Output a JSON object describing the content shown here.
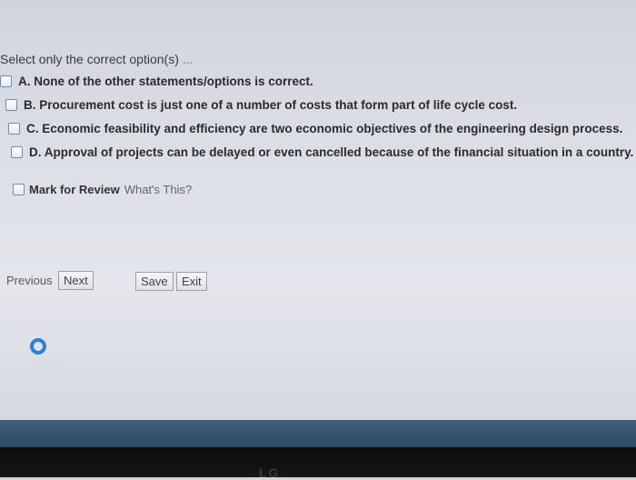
{
  "instruction": {
    "text": "Select only the correct option(s)",
    "ellipsis": "..."
  },
  "options": [
    {
      "label": "A. None of the other statements/options is correct."
    },
    {
      "label": "B. Procurement cost is just one of a number of costs that form part of life cycle cost."
    },
    {
      "label": "C. Economic feasibility and efficiency are two economic objectives of the engineering design process."
    },
    {
      "label": "D. Approval of projects can be delayed or even cancelled because of the financial situation in a country."
    }
  ],
  "review": {
    "label": "Mark for Review",
    "help_link": "What's This?"
  },
  "nav": {
    "previous": "Previous",
    "next": "Next",
    "save": "Save",
    "exit": "Exit"
  },
  "bezel": {
    "brand": "LG"
  },
  "colors": {
    "checkbox_border": "#6d8fb5",
    "spinner": "#2f7fd4",
    "taskbar": "#3f5f7c"
  }
}
